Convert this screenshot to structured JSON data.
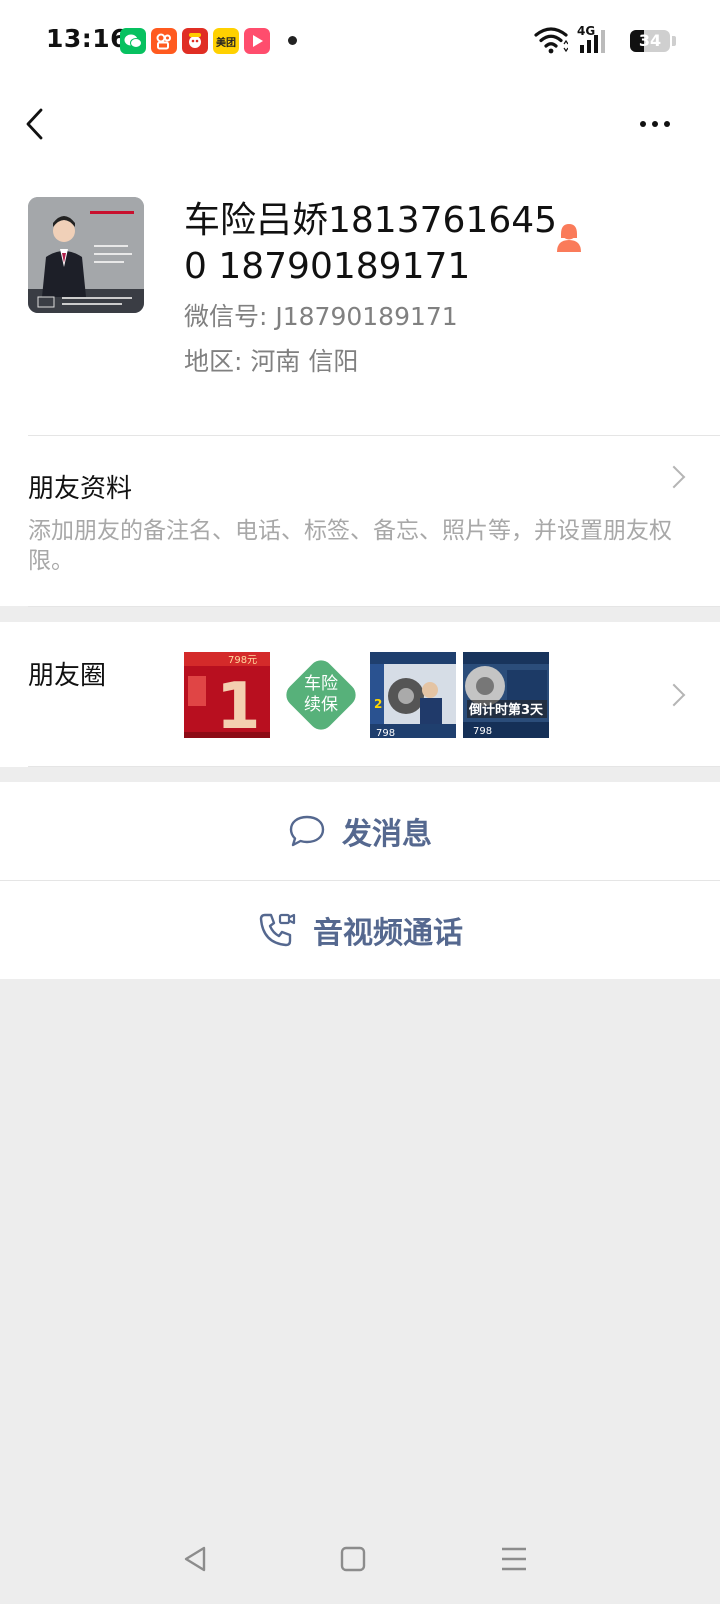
{
  "status_bar": {
    "time": "13:16",
    "network": "4G",
    "battery": "34",
    "battery_level": 0.34,
    "apps": [
      {
        "icon": "wechat-icon",
        "color": "#07c160",
        "label": ""
      },
      {
        "icon": "kuaishou-icon",
        "color": "#ff5a1f",
        "label": ""
      },
      {
        "icon": "pinduoduo-icon",
        "color": "#e02e24",
        "label": ""
      },
      {
        "icon": "meituan-icon",
        "color": "#ffd100",
        "label": "美团"
      },
      {
        "icon": "video-icon",
        "color": "#ff4d6d",
        "label": ""
      }
    ]
  },
  "header": {
    "back_icon": "chevron-left-icon",
    "more_icon": "more-dots-icon"
  },
  "profile": {
    "name": "车险吕娇18137616450 18790189171",
    "wechat_id": "微信号: J18790189171",
    "region": "地区: 河南  信阳",
    "gender_icon": "female-user-icon",
    "gender_color": "#fa7b5a"
  },
  "friend_info": {
    "title": "朋友资料",
    "description": "添加朋友的备注名、电话、标签、备忘、照片等，并设置朋友权限。"
  },
  "moments": {
    "title": "朋友圈",
    "thumbnails": [
      {
        "name": "moment-photo-countdown-1",
        "price_text": "798元",
        "big_text": "1",
        "accent": "#c8102e"
      },
      {
        "name": "moment-photo-renewal",
        "badge_text_1": "车险",
        "badge_text_2": "续保",
        "accent": "#57b17a"
      },
      {
        "name": "moment-photo-mechanic",
        "price_text": "798",
        "big_text": "2",
        "accent": "#1f3f6e"
      },
      {
        "name": "moment-photo-countdown-3",
        "headline": "倒计时第3天",
        "price_text": "798",
        "accent": "#2b4d7a"
      }
    ]
  },
  "actions": {
    "message_label": "发消息",
    "message_icon": "chat-bubble-icon",
    "call_label": "音视频通话",
    "call_icon": "phone-video-icon",
    "accent": "#55688f"
  },
  "nav_bar": {
    "back_icon": "nav-back-icon",
    "home_icon": "nav-home-icon",
    "menu_icon": "nav-menu-icon"
  }
}
